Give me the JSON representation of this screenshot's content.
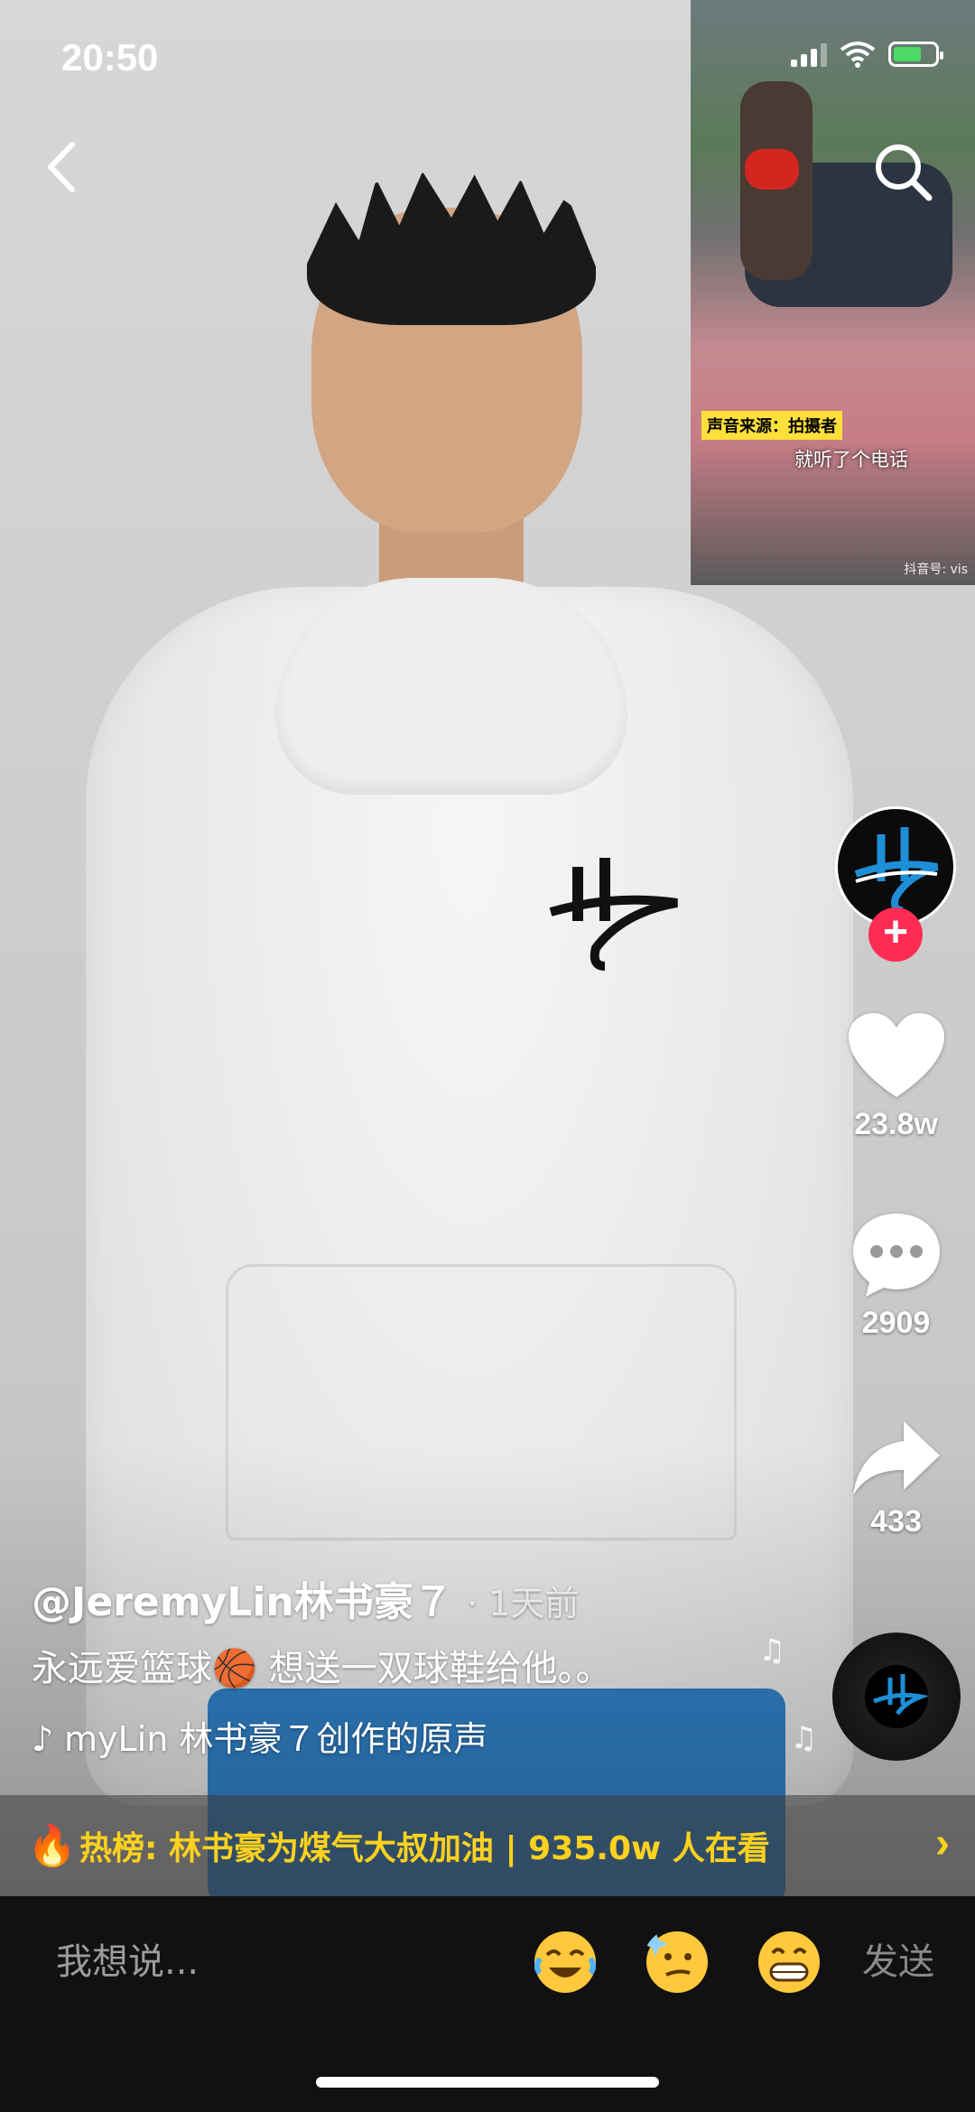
{
  "status_bar": {
    "time": "20:50"
  },
  "inset_video": {
    "tag": "声音来源：拍摄者",
    "subtitle": "就听了个电话",
    "watermark": "抖音号: vis"
  },
  "actions": {
    "like_count": "23.8w",
    "comment_count": "2909",
    "share_count": "433"
  },
  "caption": {
    "author": "@JeremyLin林书豪７",
    "time": "· 1天前",
    "description": "永远爱篮球🏀 想送一双球鞋给他。。",
    "music": "myLin 林书豪７创作的原声"
  },
  "hot_bar": {
    "text": "热榜: 林书豪为煤气大叔加油 | 935.0w 人在看",
    "chevron": "›"
  },
  "input_bar": {
    "placeholder": "我想说...",
    "send_label": "发送"
  },
  "colors": {
    "follow": "#fe2c55",
    "hot": "#ffd21e",
    "accent_logo": "#1e8fd6"
  },
  "icons": [
    "back-icon",
    "search-icon",
    "heart-icon",
    "comment-icon",
    "share-icon",
    "music-disc-icon",
    "flame-icon",
    "emoji-icon"
  ]
}
